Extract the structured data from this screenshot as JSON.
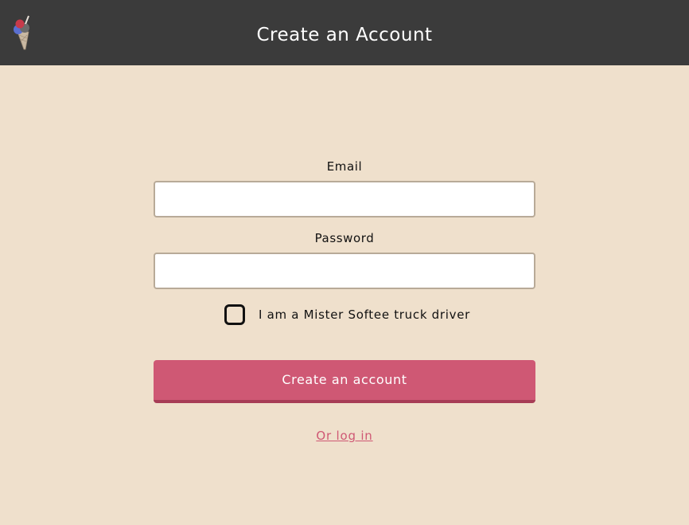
{
  "header": {
    "title": "Create an Account",
    "logo_icon": "ice-cream-cone-icon",
    "background_color": "#3b3b3b"
  },
  "form": {
    "email_label": "Email",
    "email_value": "",
    "email_placeholder": "",
    "password_label": "Password",
    "password_value": "",
    "password_placeholder": "",
    "driver_checkbox_label": "I am a Mister Softee truck driver",
    "driver_checked": false,
    "submit_label": "Create an account",
    "login_link_label": "Or log in"
  },
  "colors": {
    "page_background": "#efe0cc",
    "accent": "#cf5874",
    "accent_dark": "#a73d56",
    "input_border": "#b8aa98"
  }
}
